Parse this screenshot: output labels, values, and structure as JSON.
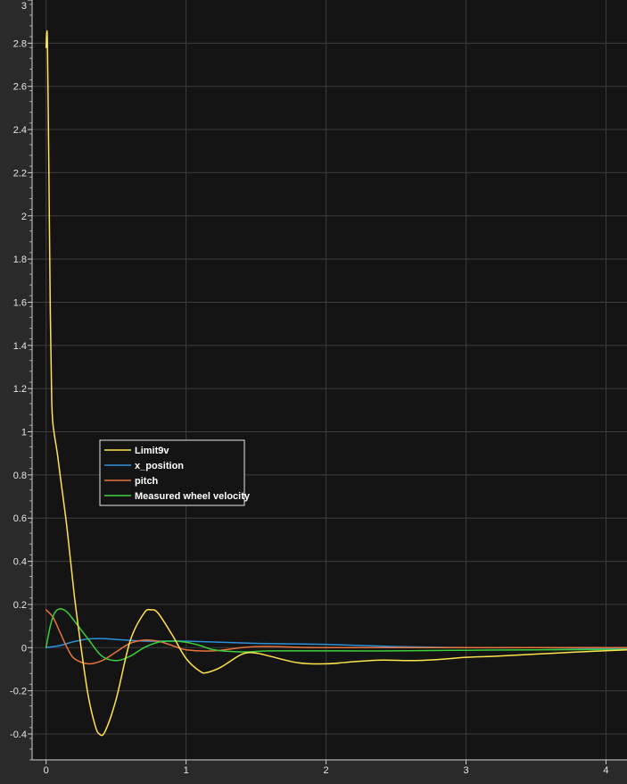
{
  "chart_data": {
    "type": "line",
    "title": "",
    "xlabel": "",
    "ylabel": "",
    "xlim": [
      -0.1,
      4.15
    ],
    "ylim": [
      -0.52,
      3.0
    ],
    "grid": true,
    "legend_position": "center-left",
    "x_ticks": [
      0,
      1,
      2,
      3,
      4
    ],
    "x_tick_labels": [
      "0",
      "1",
      "2",
      "3",
      "4"
    ],
    "y_ticks": [
      -0.4,
      -0.2,
      0,
      0.2,
      0.4,
      0.6,
      0.8,
      1,
      1.2,
      1.4,
      1.6,
      1.8,
      2,
      2.2,
      2.4,
      2.6,
      2.8,
      3
    ],
    "y_tick_labels": [
      "-0.4",
      "-0.2",
      "0",
      "0.2",
      "0.4",
      "0.6",
      "0.8",
      "1",
      "1.2",
      "1.4",
      "1.6",
      "1.8",
      "2",
      "2.2",
      "2.4",
      "2.6",
      "2.8",
      "3"
    ],
    "series": [
      {
        "name": "Limit9v",
        "color": "#ffe34d",
        "points": [
          [
            0,
            2.78
          ],
          [
            0.005,
            2.85
          ],
          [
            0.01,
            2.78
          ],
          [
            0.02,
            2.2
          ],
          [
            0.03,
            1.55
          ],
          [
            0.04,
            1.15
          ],
          [
            0.05,
            1.03
          ],
          [
            0.08,
            0.9
          ],
          [
            0.1,
            0.8
          ],
          [
            0.15,
            0.55
          ],
          [
            0.2,
            0.25
          ],
          [
            0.25,
            0.0
          ],
          [
            0.3,
            -0.22
          ],
          [
            0.35,
            -0.36
          ],
          [
            0.38,
            -0.4
          ],
          [
            0.42,
            -0.39
          ],
          [
            0.5,
            -0.24
          ],
          [
            0.6,
            0.03
          ],
          [
            0.7,
            0.16
          ],
          [
            0.75,
            0.175
          ],
          [
            0.8,
            0.16
          ],
          [
            0.9,
            0.06
          ],
          [
            1.0,
            -0.05
          ],
          [
            1.1,
            -0.11
          ],
          [
            1.15,
            -0.115
          ],
          [
            1.25,
            -0.09
          ],
          [
            1.4,
            -0.03
          ],
          [
            1.5,
            -0.025
          ],
          [
            1.6,
            -0.04
          ],
          [
            1.8,
            -0.07
          ],
          [
            2.0,
            -0.075
          ],
          [
            2.2,
            -0.065
          ],
          [
            2.4,
            -0.058
          ],
          [
            2.6,
            -0.06
          ],
          [
            2.8,
            -0.055
          ],
          [
            3.0,
            -0.045
          ],
          [
            3.2,
            -0.04
          ],
          [
            3.5,
            -0.03
          ],
          [
            3.8,
            -0.02
          ],
          [
            4.15,
            -0.01
          ]
        ]
      },
      {
        "name": "x_position",
        "color": "#2f8fd8",
        "points": [
          [
            0,
            0.0
          ],
          [
            0.1,
            0.01
          ],
          [
            0.2,
            0.028
          ],
          [
            0.3,
            0.04
          ],
          [
            0.4,
            0.042
          ],
          [
            0.5,
            0.038
          ],
          [
            0.7,
            0.03
          ],
          [
            1.0,
            0.03
          ],
          [
            1.5,
            0.02
          ],
          [
            2.0,
            0.015
          ],
          [
            2.5,
            0.005
          ],
          [
            3.0,
            0.0
          ],
          [
            3.5,
            0.0
          ],
          [
            4.15,
            -0.005
          ]
        ]
      },
      {
        "name": "pitch",
        "color": "#e8743c",
        "points": [
          [
            0,
            0.175
          ],
          [
            0.05,
            0.14
          ],
          [
            0.1,
            0.07
          ],
          [
            0.15,
            0.0
          ],
          [
            0.2,
            -0.05
          ],
          [
            0.3,
            -0.075
          ],
          [
            0.4,
            -0.06
          ],
          [
            0.5,
            -0.02
          ],
          [
            0.6,
            0.02
          ],
          [
            0.7,
            0.035
          ],
          [
            0.8,
            0.03
          ],
          [
            0.9,
            0.01
          ],
          [
            1.0,
            -0.01
          ],
          [
            1.2,
            -0.015
          ],
          [
            1.5,
            0.005
          ],
          [
            2.0,
            0.0
          ],
          [
            3.0,
            0.0
          ],
          [
            4.15,
            0.0
          ]
        ]
      },
      {
        "name": "Measured wheel velocity",
        "color": "#3ccf3c",
        "points": [
          [
            0,
            0.0
          ],
          [
            0.03,
            0.1
          ],
          [
            0.06,
            0.16
          ],
          [
            0.1,
            0.18
          ],
          [
            0.15,
            0.165
          ],
          [
            0.2,
            0.125
          ],
          [
            0.3,
            0.04
          ],
          [
            0.4,
            -0.04
          ],
          [
            0.5,
            -0.06
          ],
          [
            0.6,
            -0.04
          ],
          [
            0.7,
            0.0
          ],
          [
            0.8,
            0.025
          ],
          [
            0.9,
            0.03
          ],
          [
            1.0,
            0.025
          ],
          [
            1.1,
            0.01
          ],
          [
            1.2,
            -0.01
          ],
          [
            1.4,
            -0.02
          ],
          [
            1.6,
            -0.015
          ],
          [
            2.0,
            -0.015
          ],
          [
            2.5,
            -0.015
          ],
          [
            3.0,
            -0.012
          ],
          [
            3.5,
            -0.01
          ],
          [
            4.15,
            -0.008
          ]
        ]
      }
    ]
  }
}
